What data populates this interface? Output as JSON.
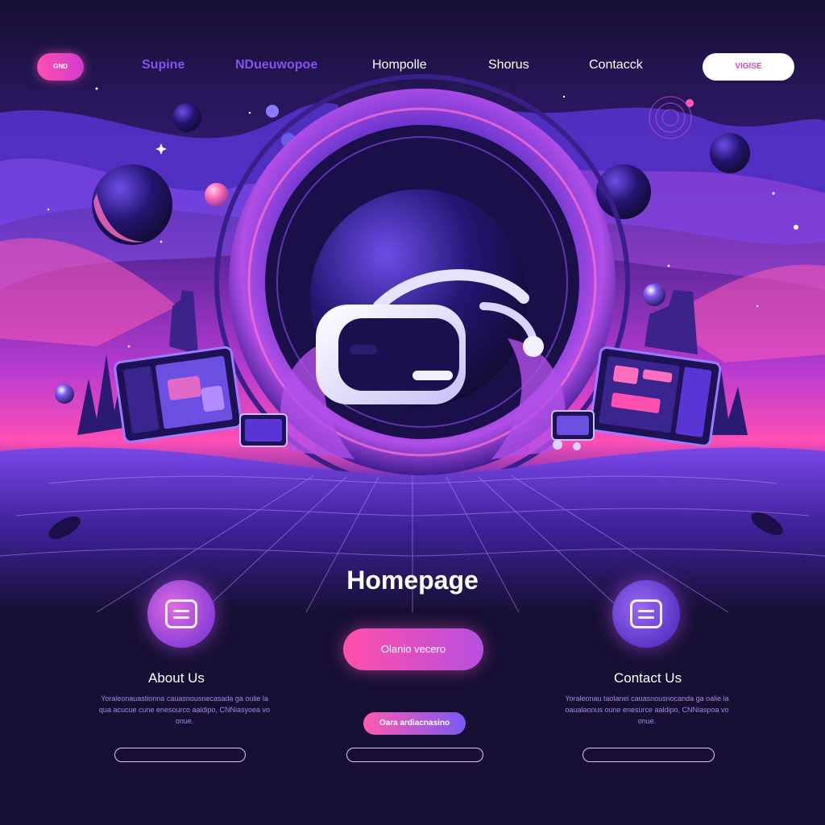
{
  "nav": {
    "pill_label": "GND",
    "links": [
      "Supine",
      "NDueuwopoe",
      "Hompolle",
      "Shorus",
      "Contacck"
    ],
    "cta_label": "VIGISE"
  },
  "main": {
    "title": "Homepage",
    "cta_label": "Olanio vecero",
    "secondary_cta_label": "Oara ardiacnasino"
  },
  "about": {
    "heading": "About Us",
    "text": "Yoraleonauastionna cauasnousnecasada ga oulie la qua acucue cune enesourco aaldipo, CNNiasyoea vo onue."
  },
  "contact": {
    "heading": "Contact Us",
    "text": "Yoraleonau taolanei cauasnousnocanda ga oalie la oaualaonus oune enesurce aaldipo, CNNiaspoa vo onue."
  },
  "colors": {
    "background": "#160f33",
    "accent_pink": "#ff4fb0",
    "accent_purple": "#8a4ff0"
  }
}
